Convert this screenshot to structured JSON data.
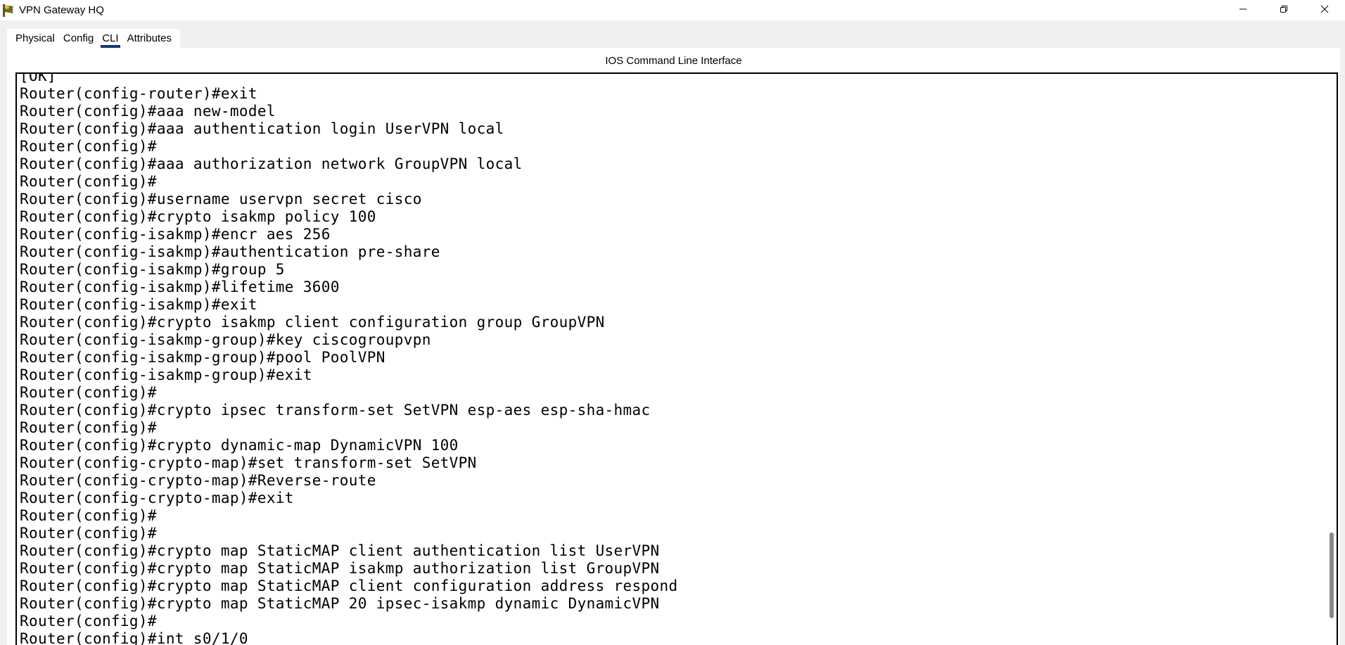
{
  "window": {
    "title": "VPN Gateway HQ",
    "icon": "packet-tracer-router-icon",
    "controls": [
      "minimize-icon",
      "restore-icon",
      "close-icon"
    ]
  },
  "tabs": [
    {
      "label": "Physical",
      "active": false
    },
    {
      "label": "Config",
      "active": false
    },
    {
      "label": "CLI",
      "active": true
    },
    {
      "label": "Attributes",
      "active": false
    }
  ],
  "panel": {
    "title": "IOS Command Line Interface"
  },
  "cli": {
    "lines": [
      "[OK]",
      "Router(config-router)#exit",
      "Router(config)#aaa new-model",
      "Router(config)#aaa authentication login UserVPN local",
      "Router(config)#",
      "Router(config)#aaa authorization network GroupVPN local",
      "Router(config)#",
      "Router(config)#username uservpn secret cisco",
      "Router(config)#crypto isakmp policy 100",
      "Router(config-isakmp)#encr aes 256",
      "Router(config-isakmp)#authentication pre-share",
      "Router(config-isakmp)#group 5",
      "Router(config-isakmp)#lifetime 3600",
      "Router(config-isakmp)#exit",
      "Router(config)#crypto isakmp client configuration group GroupVPN",
      "Router(config-isakmp-group)#key ciscogroupvpn",
      "Router(config-isakmp-group)#pool PoolVPN",
      "Router(config-isakmp-group)#exit",
      "Router(config)#",
      "Router(config)#crypto ipsec transform-set SetVPN esp-aes esp-sha-hmac",
      "Router(config)#",
      "Router(config)#crypto dynamic-map DynamicVPN 100",
      "Router(config-crypto-map)#set transform-set SetVPN",
      "Router(config-crypto-map)#Reverse-route",
      "Router(config-crypto-map)#exit",
      "Router(config)#",
      "Router(config)#",
      "Router(config)#crypto map StaticMAP client authentication list UserVPN",
      "Router(config)#crypto map StaticMAP isakmp authorization list GroupVPN",
      "Router(config)#crypto map StaticMAP client configuration address respond",
      "Router(config)#crypto map StaticMAP 20 ipsec-isakmp dynamic DynamicVPN",
      "Router(config)#",
      "Router(config)#int s0/1/0"
    ]
  }
}
